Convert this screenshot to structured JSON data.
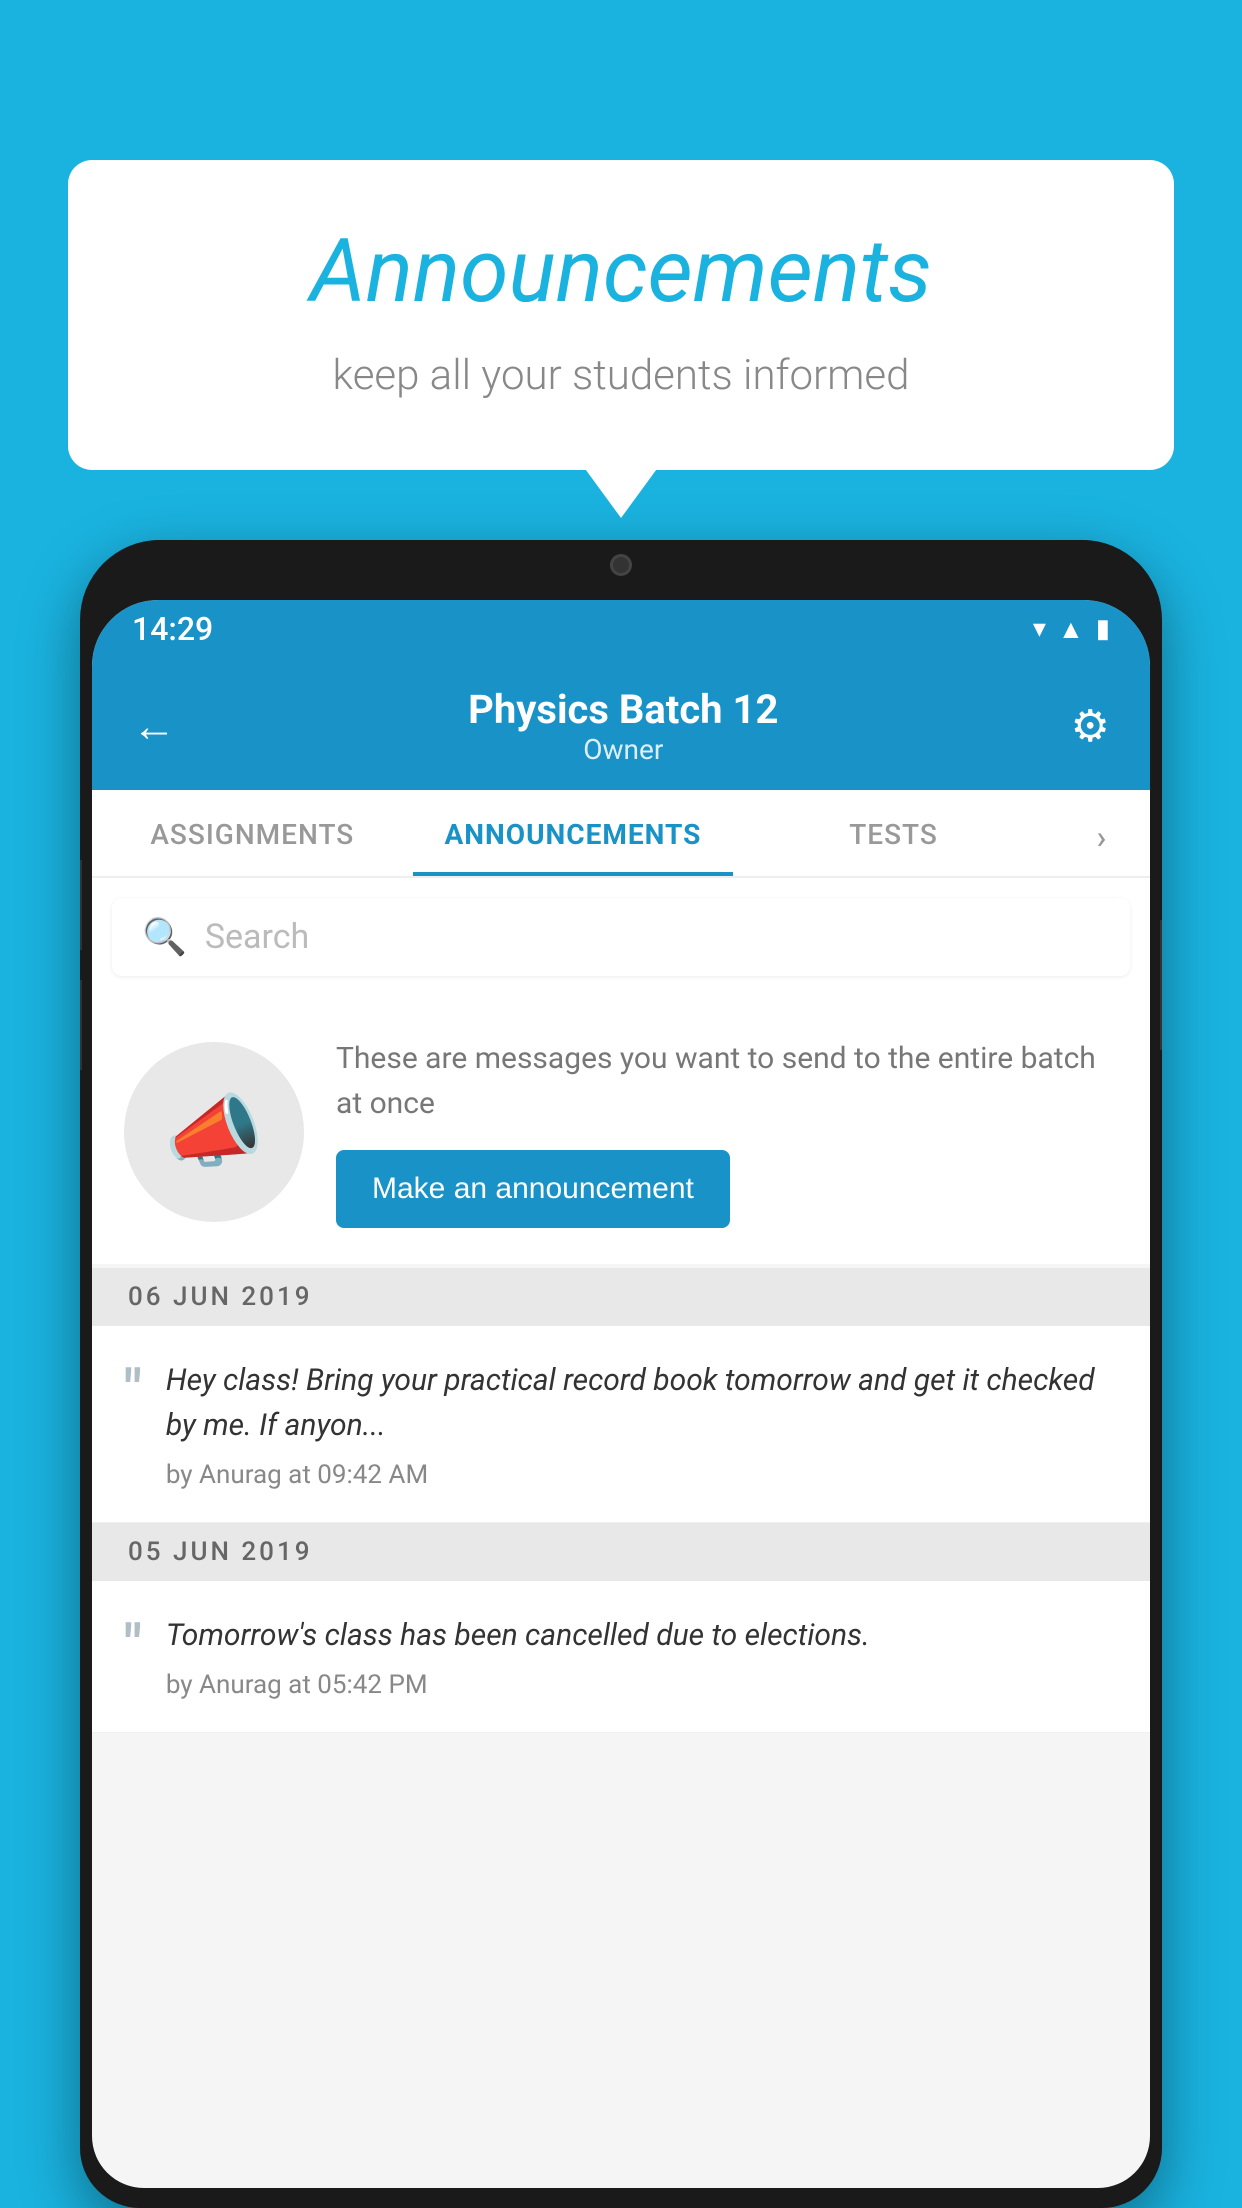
{
  "bubble": {
    "title": "Announcements",
    "subtitle": "keep all your students informed"
  },
  "status_bar": {
    "time": "14:29",
    "icons": [
      "wifi",
      "signal",
      "battery"
    ]
  },
  "header": {
    "title": "Physics Batch 12",
    "subtitle": "Owner",
    "back_label": "←",
    "gear_label": "⚙"
  },
  "tabs": [
    {
      "label": "ASSIGNMENTS",
      "active": false
    },
    {
      "label": "ANNOUNCEMENTS",
      "active": true
    },
    {
      "label": "TESTS",
      "active": false
    },
    {
      "label": "›",
      "active": false
    }
  ],
  "search": {
    "placeholder": "Search"
  },
  "promo": {
    "text": "These are messages you want to send to the entire batch at once",
    "button_label": "Make an announcement"
  },
  "announcements": [
    {
      "date": "06  JUN  2019",
      "text": "Hey class! Bring your practical record book tomorrow and get it checked by me. If anyon...",
      "meta": "by Anurag at 09:42 AM"
    },
    {
      "date": "05  JUN  2019",
      "text": "Tomorrow's class has been cancelled due to elections.",
      "meta": "by Anurag at 05:42 PM"
    }
  ],
  "colors": {
    "primary": "#1992c8",
    "background": "#1ab3e0",
    "white": "#ffffff",
    "gray_bg": "#e8e8e8"
  }
}
